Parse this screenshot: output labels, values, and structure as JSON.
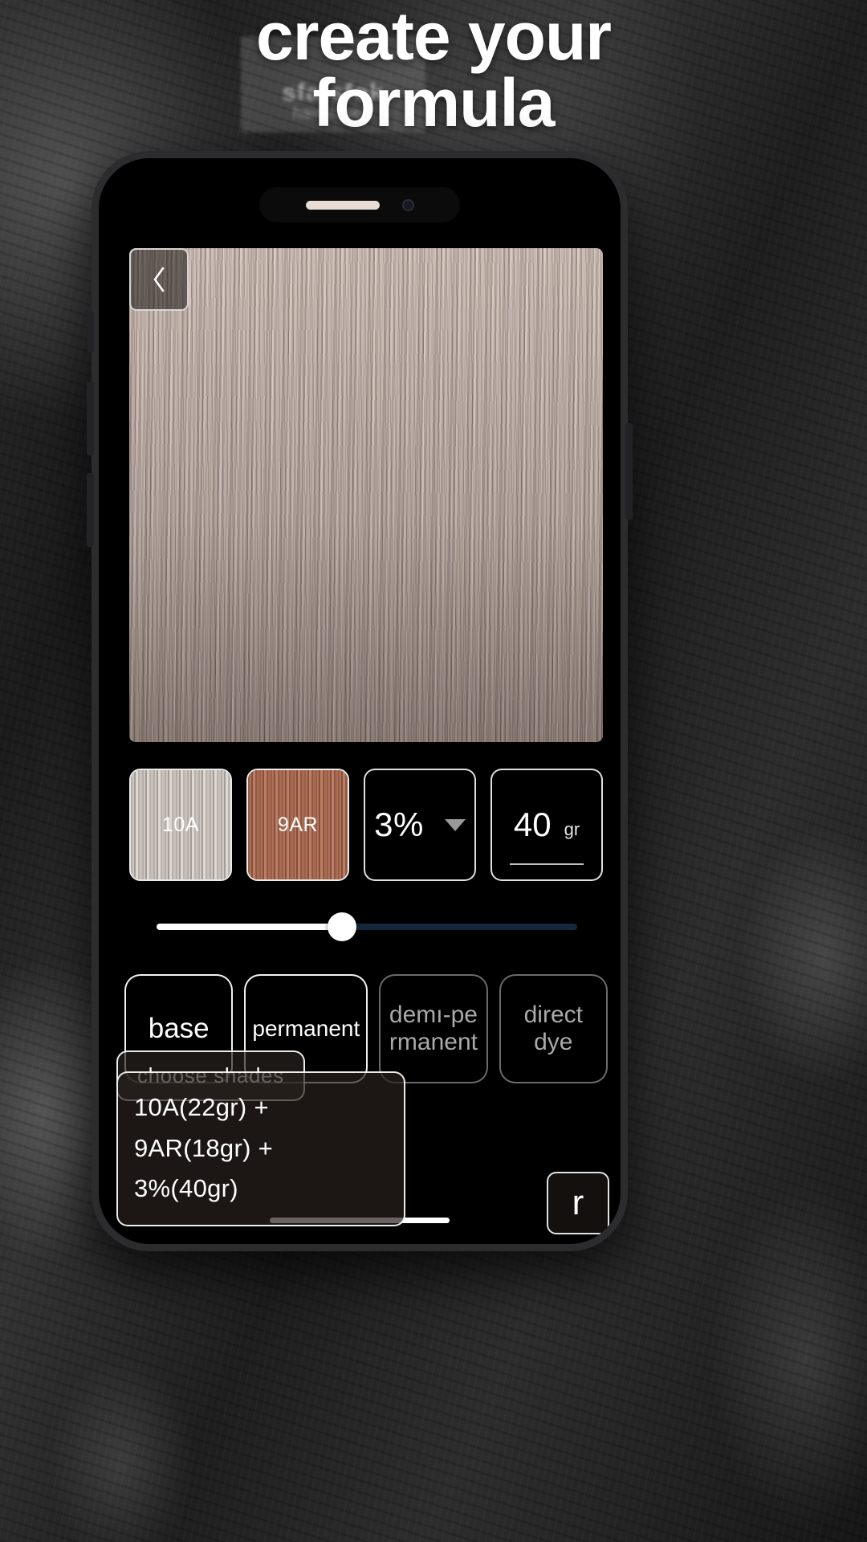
{
  "headline": {
    "line1": "create your",
    "line2": "formula"
  },
  "background": {
    "product_label_line1": "sfatsfok",
    "product_label_line2": "hair expert"
  },
  "phone": {
    "back_button": {
      "icon": "chevron-left-icon"
    },
    "hero": {
      "choose_shades_label": "choose  shades",
      "formula_line1": "10A(22gr) + 9AR(18gr) +",
      "formula_line2": "3%(40gr)",
      "reset_label": "r"
    },
    "selection_row": {
      "shade1": {
        "label": "10A",
        "color": "#c0b8b2"
      },
      "shade2": {
        "label": "9AR",
        "color": "#9e6349"
      },
      "developer": {
        "value": "3%",
        "icon": "chevron-down-icon"
      },
      "amount": {
        "value": "40",
        "unit": "gr"
      }
    },
    "slider": {
      "value_percent": 44,
      "fill_color": "#ffffff",
      "track_color": "#13293b"
    },
    "type_buttons": [
      {
        "label": "base",
        "selected": true
      },
      {
        "label": "permanent",
        "selected": true
      },
      {
        "label": "demı-pe rmanent",
        "selected": false
      },
      {
        "label": "direct dye",
        "selected": false
      }
    ]
  }
}
